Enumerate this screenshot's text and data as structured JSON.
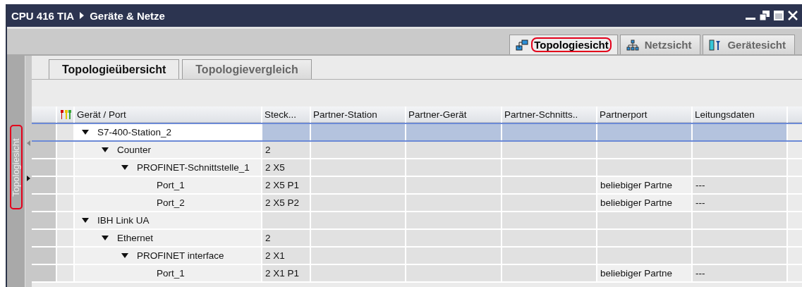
{
  "window": {
    "breadcrumb": [
      "CPU 416 TIA",
      "Geräte & Netze"
    ]
  },
  "view_tabs": [
    {
      "label": "Topologiesicht",
      "kind": "topology",
      "selected": true,
      "highlighted": true
    },
    {
      "label": "Netzsicht",
      "kind": "network",
      "selected": false,
      "highlighted": false
    },
    {
      "label": "Gerätesicht",
      "kind": "device",
      "selected": false,
      "highlighted": false
    }
  ],
  "side_tab": {
    "label": "Topologiesicht",
    "highlighted": true
  },
  "sub_tabs": [
    {
      "label": "Topologieübersicht",
      "selected": true
    },
    {
      "label": "Topologievergleich",
      "selected": false
    }
  ],
  "table": {
    "columns": [
      "Gerät / Port",
      "Steck...",
      "Partner-Station",
      "Partner-Gerät",
      "Partner-Schnitts..",
      "Partnerport",
      "Leitungsdaten"
    ],
    "rows": [
      {
        "name": "S7-400-Station_2",
        "expanded": true,
        "selected": true,
        "children": [
          {
            "name": "Counter",
            "expanded": true,
            "selected": false,
            "slot": "2",
            "children": [
              {
                "name": "PROFINET-Schnittstelle_1",
                "expanded": true,
                "selected": false,
                "slot": "2 X5",
                "children": [
                  {
                    "name": "Port_1",
                    "selected": false,
                    "slot": "2 X5 P1",
                    "partner_port": "beliebiger Partne",
                    "line_data": "---"
                  },
                  {
                    "name": "Port_2",
                    "selected": false,
                    "slot": "2 X5 P2",
                    "partner_port": "beliebiger Partne",
                    "line_data": "---"
                  }
                ]
              }
            ]
          }
        ]
      },
      {
        "name": "IBH Link UA",
        "expanded": true,
        "selected": false,
        "children": [
          {
            "name": "Ethernet",
            "expanded": true,
            "selected": false,
            "slot": "2",
            "children": [
              {
                "name": "PROFINET interface",
                "expanded": true,
                "selected": false,
                "slot": "2 X1",
                "children": [
                  {
                    "name": "Port_1",
                    "selected": false,
                    "slot": "2 X1 P1",
                    "partner_port": "beliebiger Partne",
                    "line_data": "---"
                  }
                ]
              }
            ]
          }
        ]
      }
    ]
  }
}
